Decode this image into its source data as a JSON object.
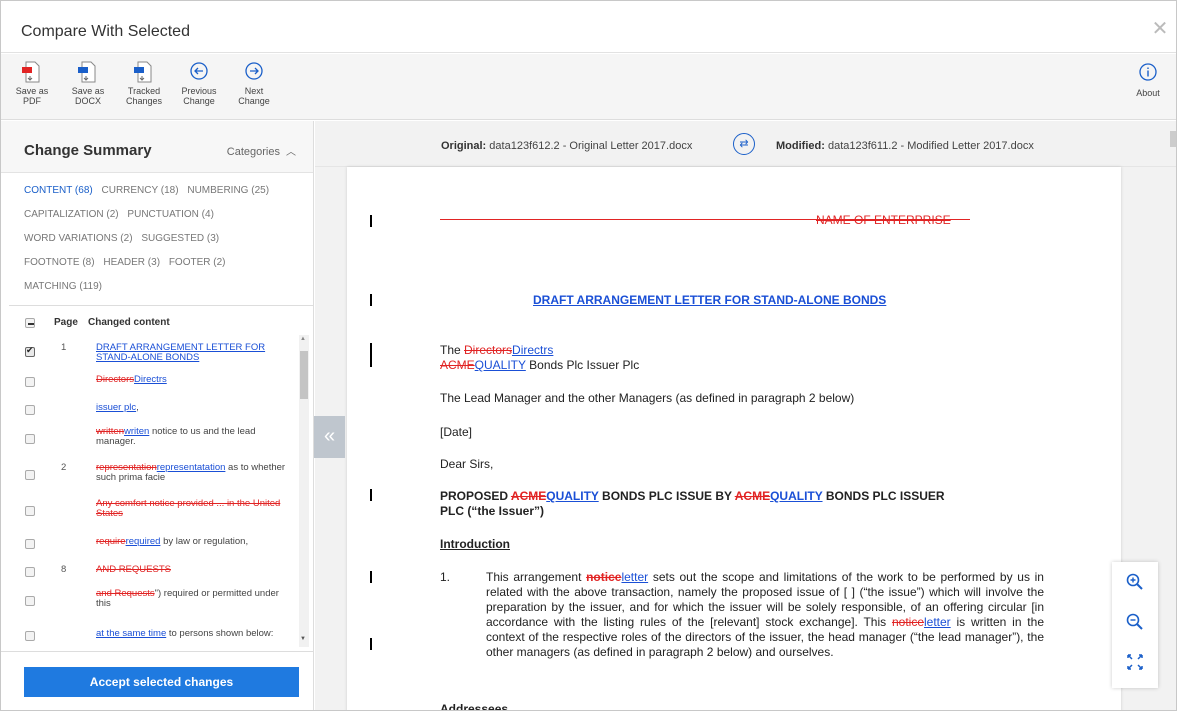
{
  "window": {
    "title": "Compare With Selected"
  },
  "toolbar": {
    "save_pdf": [
      "Save as",
      "PDF"
    ],
    "save_docx": [
      "Save as",
      "DOCX"
    ],
    "tracked": [
      "Tracked",
      "Changes"
    ],
    "previous": [
      "Previous",
      "Change"
    ],
    "next": [
      "Next",
      "Change"
    ],
    "about": "About"
  },
  "summary": {
    "title": "Change Summary",
    "categories_label": "Categories",
    "categories": [
      "CONTENT (68)",
      "CURRENCY (18)",
      "NUMBERING (25)",
      "CAPITALIZATION (2)",
      "PUNCTUATION (4)",
      "WORD VARIATIONS (2)",
      "SUGGESTED (3)",
      "FOOTNOTE (8)",
      "HEADER (3)",
      "FOOTER (2)",
      "MATCHING (119)"
    ],
    "col_page": "Page",
    "col_content": "Changed content",
    "rows": [
      {
        "page": "1",
        "ins": "DRAFT ARRANGEMENT LETTER FOR STAND-ALONE BONDS",
        "checked": true
      },
      {
        "page": "",
        "del": "Directors",
        "ins": "Directrs"
      },
      {
        "page": "",
        "ins": "issuer plc",
        "rest": ","
      },
      {
        "page": "",
        "del": "written",
        "ins": "writen",
        "rest": " notice to us and the lead manager."
      },
      {
        "page": "2",
        "del": "representation",
        "ins": "representatation",
        "rest": " as to whether such prima facie"
      },
      {
        "page": "",
        "del": "Any comfort notice provided ... in the United States"
      },
      {
        "page": "",
        "del": "require",
        "ins": "required",
        "rest": " by law or regulation,"
      },
      {
        "page": "8",
        "del": "AND REQUESTS"
      },
      {
        "page": "",
        "del": "and Requests",
        "rest": "\") required or permitted under this"
      },
      {
        "page": "",
        "ins": "at the same time",
        "rest": " to persons shown below:"
      }
    ],
    "accept_button": "Accept selected changes"
  },
  "compare": {
    "original_label": "Original:",
    "original_file": "data123f612.2 - Original Letter 2017.docx",
    "modified_label": "Modified:",
    "modified_file": "data123f611.2 - Modified Letter 2017.docx"
  },
  "document": {
    "name_of_enterprise": "NAME OF ENTERPRISE",
    "heading": "DRAFT ARRANGEMENT LETTER FOR STAND-ALONE BONDS",
    "the": "The ",
    "directors_del": "Directors",
    "directors_ins": "Directrs",
    "acme": "ACME",
    "quality": "QUALITY",
    "bonds_issuer": " Bonds Plc Issuer Plc",
    "lead_manager_line": "The Lead Manager and the other Managers (as defined in paragraph 2 below)",
    "date": "[Date]",
    "dear": "Dear Sirs,",
    "proposed_1": "PROPOSED ",
    "proposed_2": " BONDS PLC ISSUE BY ",
    "proposed_3": " BONDS PLC ISSUER",
    "proposed_4": "PLC (“the Issuer”)",
    "introduction": "Introduction",
    "para_num": "1.",
    "para_1": "This arrangement ",
    "notice_del": "notice",
    "letter_ins": "letter",
    "para_2": " sets out the scope and limitations of the work to be performed by us in related with the above transaction, namely the proposed issue of [     ] (“the issue”) which will involve the preparation by the issuer, and for which the issuer will be solely responsible, of an offering circular [in accordance with the listing rules of the [relevant] stock exchange]. This ",
    "para_3": " is written in the context of the respective roles of the directors of the issuer, the head manager (“the lead manager”), the other managers (as defined in paragraph 2 below) and ourselves.",
    "addressees": "Addressees"
  },
  "colors": {
    "accent": "#1f7ae0",
    "insert": "#1a4fd6",
    "delete": "#e12424"
  }
}
